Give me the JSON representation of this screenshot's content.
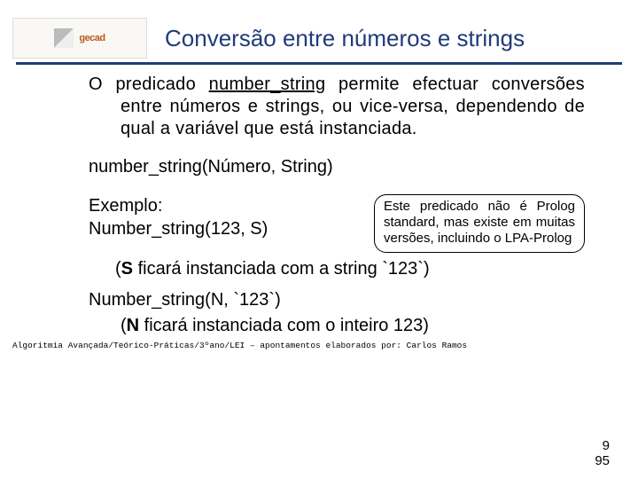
{
  "header": {
    "logo_word": "gecad",
    "title": "Conversão entre números e strings"
  },
  "body": {
    "para_lead": "O predicado ",
    "para_pred": "number_string",
    "para_rest": " permite efectuar conversões entre números e strings, ou vice-versa, dependendo de qual a variável que está instanciada.",
    "signature": "number_string(Número, String)",
    "example_label": "Exemplo:",
    "example_call": "Number_string(123, S)",
    "note": "Este predicado não é Prolog standard, mas existe em muitas versões, incluindo o LPA-Prolog",
    "result1_open": "(",
    "result1_bold": "S",
    "result1_rest": " ficará instanciada com a string `123`)",
    "call2": "Number_string(N, `123`)",
    "result2_open": "(",
    "result2_bold": "N",
    "result2_rest": " ficará instanciada com o inteiro 123)"
  },
  "footer": {
    "text": "Algoritmia Avançada/Teórico-Práticas/3ºano/LEI – apontamentos elaborados por: Carlos Ramos",
    "page_small": "9",
    "page_big": "95"
  }
}
